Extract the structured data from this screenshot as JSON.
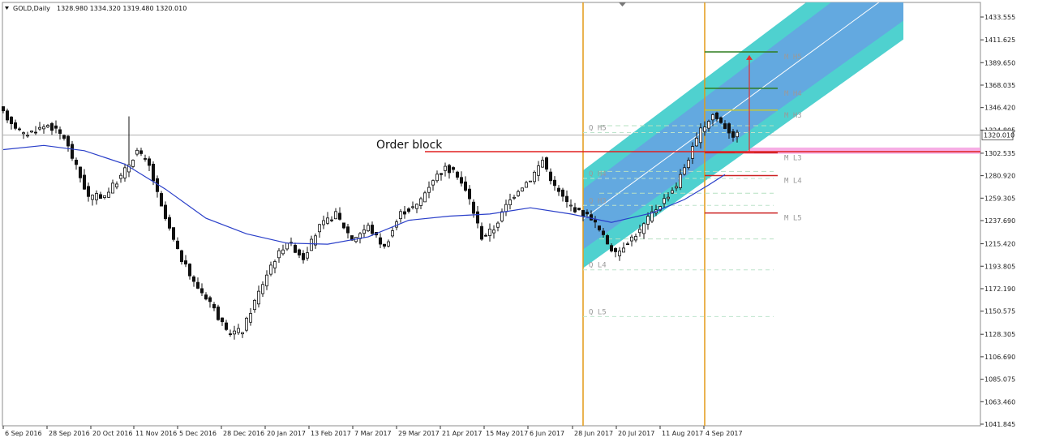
{
  "header": {
    "symbol": "GOLD,Daily",
    "ohlc": "1328.980 1334.320 1319.480 1320.010"
  },
  "chart_data": {
    "type": "candlestick",
    "title": "GOLD,Daily",
    "y_ticks": [
      1433.555,
      1411.625,
      1389.65,
      1368.035,
      1346.42,
      1324.805,
      1302.535,
      1280.92,
      1259.305,
      1237.69,
      1215.42,
      1193.805,
      1172.19,
      1150.575,
      1128.305,
      1106.69,
      1085.075,
      1063.46,
      1041.845
    ],
    "ylim": [
      1041.845,
      1433.555
    ],
    "current_price": {
      "label": "1320.010",
      "value": 1320.01
    },
    "x_ticks": [
      "6 Sep 2016",
      "28 Sep 2016",
      "20 Oct 2016",
      "11 Nov 2016",
      "5 Dec 2016",
      "28 Dec 2016",
      "20 Jan 2017",
      "13 Feb 2017",
      "7 Mar 2017",
      "29 Mar 2017",
      "21 Apr 2017",
      "15 May 2017",
      "6 Jun 2017",
      "28 Jun 2017",
      "20 Jul 2017",
      "11 Aug 2017",
      "4 Sep 2017"
    ],
    "price_path": [
      [
        0,
        1345
      ],
      [
        6,
        1320
      ],
      [
        12,
        1330
      ],
      [
        16,
        1318
      ],
      [
        22,
        1260
      ],
      [
        26,
        1262
      ],
      [
        30,
        1280
      ],
      [
        34,
        1305
      ],
      [
        37,
        1290
      ],
      [
        40,
        1250
      ],
      [
        44,
        1208
      ],
      [
        48,
        1178
      ],
      [
        52,
        1160
      ],
      [
        56,
        1130
      ],
      [
        60,
        1132
      ],
      [
        63,
        1160
      ],
      [
        67,
        1195
      ],
      [
        71,
        1218
      ],
      [
        75,
        1202
      ],
      [
        79,
        1232
      ],
      [
        83,
        1244
      ],
      [
        87,
        1220
      ],
      [
        91,
        1232
      ],
      [
        95,
        1212
      ],
      [
        99,
        1245
      ],
      [
        103,
        1252
      ],
      [
        107,
        1278
      ],
      [
        110,
        1288
      ],
      [
        113,
        1282
      ],
      [
        116,
        1258
      ],
      [
        119,
        1222
      ],
      [
        122,
        1230
      ],
      [
        125,
        1252
      ],
      [
        128,
        1268
      ],
      [
        131,
        1278
      ],
      [
        134,
        1296
      ],
      [
        137,
        1270
      ],
      [
        140,
        1255
      ],
      [
        143,
        1246
      ],
      [
        146,
        1241
      ],
      [
        149,
        1222
      ],
      [
        152,
        1205
      ],
      [
        155,
        1218
      ],
      [
        158,
        1228
      ],
      [
        161,
        1245
      ],
      [
        164,
        1258
      ],
      [
        167,
        1272
      ],
      [
        170,
        1298
      ],
      [
        173,
        1324
      ],
      [
        176,
        1340
      ],
      [
        179,
        1328
      ],
      [
        181,
        1320
      ]
    ],
    "moving_average": [
      [
        0,
        1306
      ],
      [
        10,
        1310
      ],
      [
        20,
        1305
      ],
      [
        30,
        1292
      ],
      [
        40,
        1268
      ],
      [
        50,
        1240
      ],
      [
        60,
        1225
      ],
      [
        70,
        1216
      ],
      [
        80,
        1215
      ],
      [
        90,
        1222
      ],
      [
        100,
        1238
      ],
      [
        110,
        1242
      ],
      [
        120,
        1244
      ],
      [
        130,
        1250
      ],
      [
        140,
        1244
      ],
      [
        150,
        1236
      ],
      [
        160,
        1245
      ],
      [
        168,
        1258
      ],
      [
        174,
        1272
      ],
      [
        178,
        1282
      ]
    ],
    "channel": {
      "start_bar": 143,
      "end_bar": 222,
      "inner_start": [
        1210,
        1268
      ],
      "inner_end": [
        1430,
        1500
      ],
      "outer_offset": 18
    },
    "vertical_markers": [
      {
        "bar": 143,
        "color": "#e39a17"
      },
      {
        "bar": 173,
        "color": "#e39a17"
      }
    ],
    "order_block": {
      "label": "Order block",
      "value": 1304,
      "from_bar": 104,
      "to_bar": 181
    },
    "pink_zone": {
      "low": 1302,
      "high": 1308,
      "from_bar": 181
    },
    "q_levels": [
      {
        "label": "Q H5",
        "value": 1327
      },
      {
        "label": "Q H4",
        "value": 1283
      },
      {
        "label": "Q H3",
        "value": 1257
      },
      {
        "label": "Q L4",
        "value": 1195
      },
      {
        "label": "Q L5",
        "value": 1150
      }
    ],
    "q_guides": [
      1329,
      1285,
      1264,
      1220
    ],
    "m_levels": [
      {
        "label": "M H5",
        "value": 1400,
        "color": "#2e7d1e"
      },
      {
        "label": "M H4",
        "value": 1365,
        "color": "#2e7d1e"
      },
      {
        "label": "M H3",
        "value": 1344,
        "color": "#c7c731"
      },
      {
        "label": "M L3",
        "value": 1303,
        "color": "#cc2222"
      },
      {
        "label": "M L4",
        "value": 1281,
        "color": "#cc2222"
      },
      {
        "label": "M L5",
        "value": 1245,
        "color": "#cc2222"
      }
    ],
    "target_arrow": {
      "bar": 184,
      "from": 1303,
      "to": 1397,
      "color": "#e03030"
    },
    "colors": {
      "up": "#111111",
      "down": "#111111",
      "ma": "#2a3fc9",
      "channel_outer": "#4fd1cf",
      "channel_inner": "#63a9e0",
      "order_block": "#e02020",
      "pink": "#f4a0e0"
    }
  }
}
